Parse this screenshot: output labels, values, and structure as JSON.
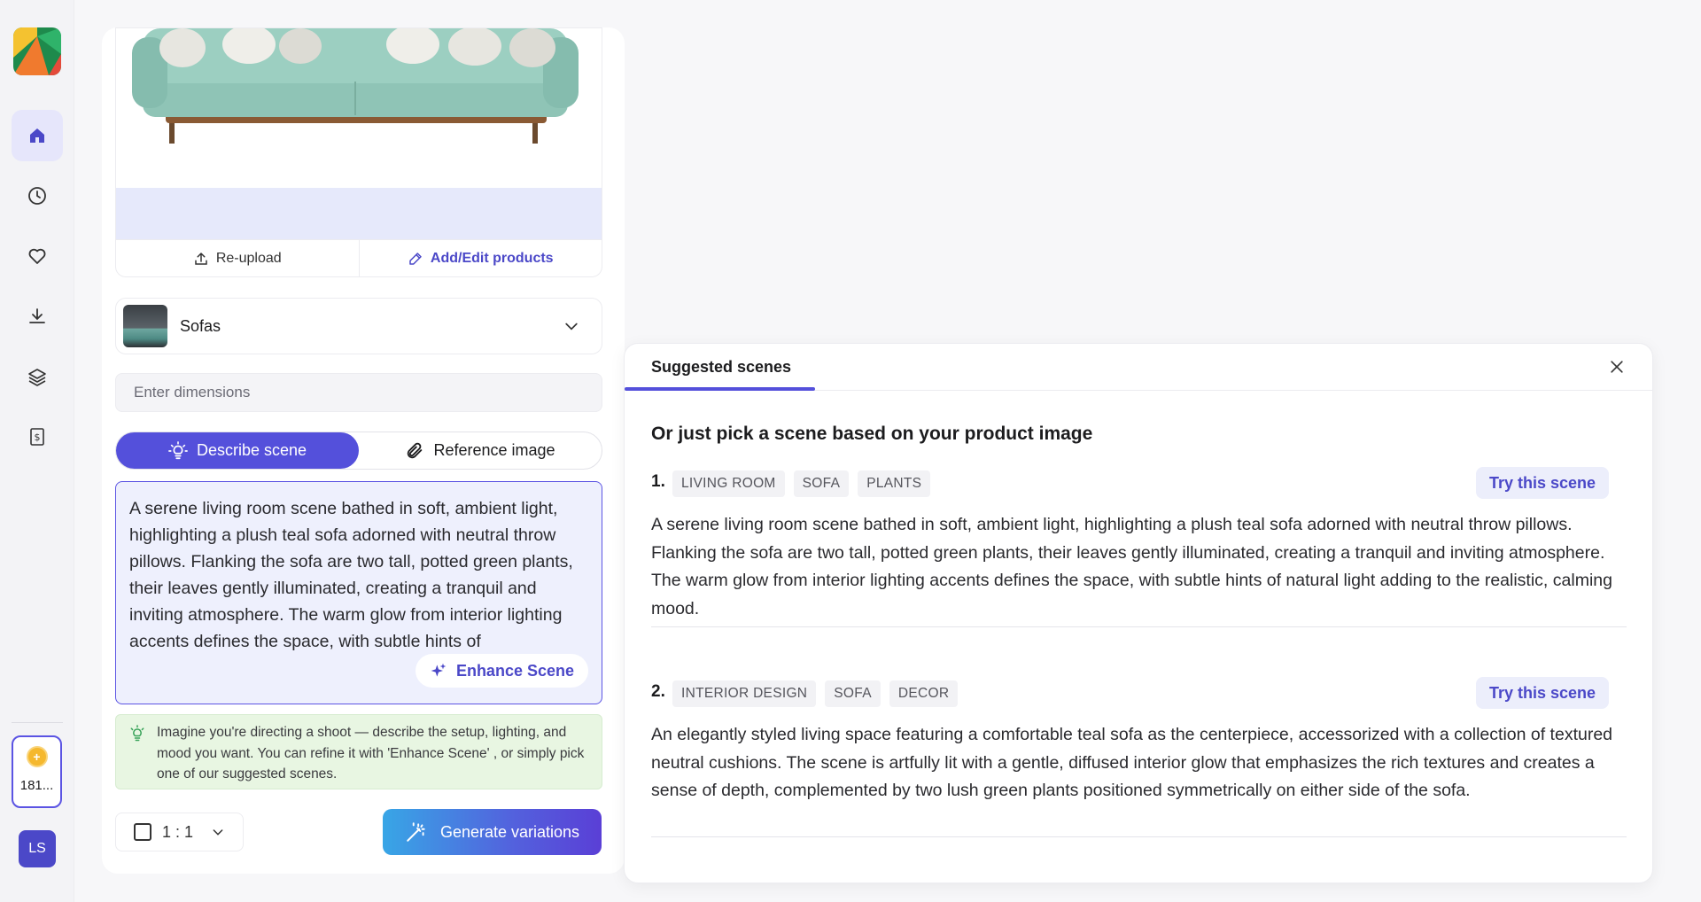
{
  "sidebar": {
    "credits": "181...",
    "avatar_initials": "LS"
  },
  "product": {
    "reupload_label": "Re-upload",
    "add_edit_label": "Add/Edit products"
  },
  "category": {
    "label": "Sofas"
  },
  "dimensions": {
    "placeholder": "Enter dimensions"
  },
  "mode_toggle": {
    "describe_label": "Describe scene",
    "reference_label": "Reference image"
  },
  "scene_input": {
    "text": "A serene living room scene bathed in soft, ambient light, highlighting a plush teal sofa adorned with neutral throw pillows. Flanking the sofa are two tall, potted green plants, their leaves gently illuminated, creating a tranquil and inviting atmosphere. The warm glow from interior lighting accents defines the space, with subtle hints of",
    "enhance_label": "Enhance Scene"
  },
  "hint": "Imagine you're directing a shoot — describe the setup, lighting, and mood you want. You can refine it with 'Enhance Scene' , or simply pick one of our suggested scenes.",
  "aspect_ratio": {
    "value": "1 : 1"
  },
  "generate_label": "Generate variations",
  "suggested": {
    "tab_label": "Suggested scenes",
    "subtitle": "Or just pick a scene based on your product image",
    "try_label": "Try this scene",
    "items": [
      {
        "number": "1.",
        "tags": [
          "LIVING ROOM",
          "SOFA",
          "PLANTS"
        ],
        "description": "A serene living room scene bathed in soft, ambient light, highlighting a plush teal sofa adorned with neutral throw pillows. Flanking the sofa are two tall, potted green plants, their leaves gently illuminated, creating a tranquil and inviting atmosphere. The warm glow from interior lighting accents defines the space, with subtle hints of natural light adding to the realistic, calming mood."
      },
      {
        "number": "2.",
        "tags": [
          "INTERIOR DESIGN",
          "SOFA",
          "DECOR"
        ],
        "description": "An elegantly styled living space featuring a comfortable teal sofa as the centerpiece, accessorized with a collection of textured neutral cushions. The scene is artfully lit with a gentle, diffused interior glow that emphasizes the rich textures and creates a sense of depth, complemented by two lush green plants positioned symmetrically on either side of the sofa."
      }
    ]
  },
  "colors": {
    "accent": "#5450db",
    "hint_bg": "#e8f6e2",
    "scene_bg": "#eef0fd"
  }
}
